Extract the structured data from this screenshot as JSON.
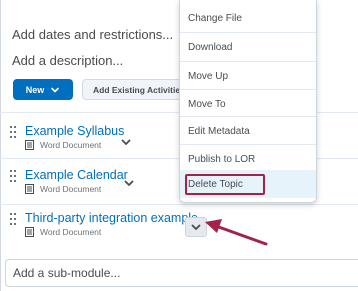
{
  "module": {
    "add_dates": "Add dates and restrictions...",
    "add_description": "Add a description...",
    "new_button": "New",
    "add_existing_button": "Add Existing Activities",
    "add_submodule": "Add a sub-module..."
  },
  "topics": [
    {
      "title": "Example Syllabus",
      "type": "Word Document"
    },
    {
      "title": "Example Calendar",
      "type": "Word Document"
    },
    {
      "title": "Third-party integration example",
      "type": "Word Document"
    }
  ],
  "context_menu": {
    "items": [
      {
        "label": "Change File"
      },
      {
        "label": "Download"
      },
      {
        "label": "Move Up"
      },
      {
        "label": "Move To"
      },
      {
        "label": "Edit Metadata"
      },
      {
        "label": "Publish to LOR"
      },
      {
        "label": "Delete Topic"
      }
    ]
  },
  "colors": {
    "accent": "#006fbf",
    "highlight_outline": "#a1234a",
    "arrow": "#a1234a",
    "menu_hover": "#e6f3fb"
  }
}
